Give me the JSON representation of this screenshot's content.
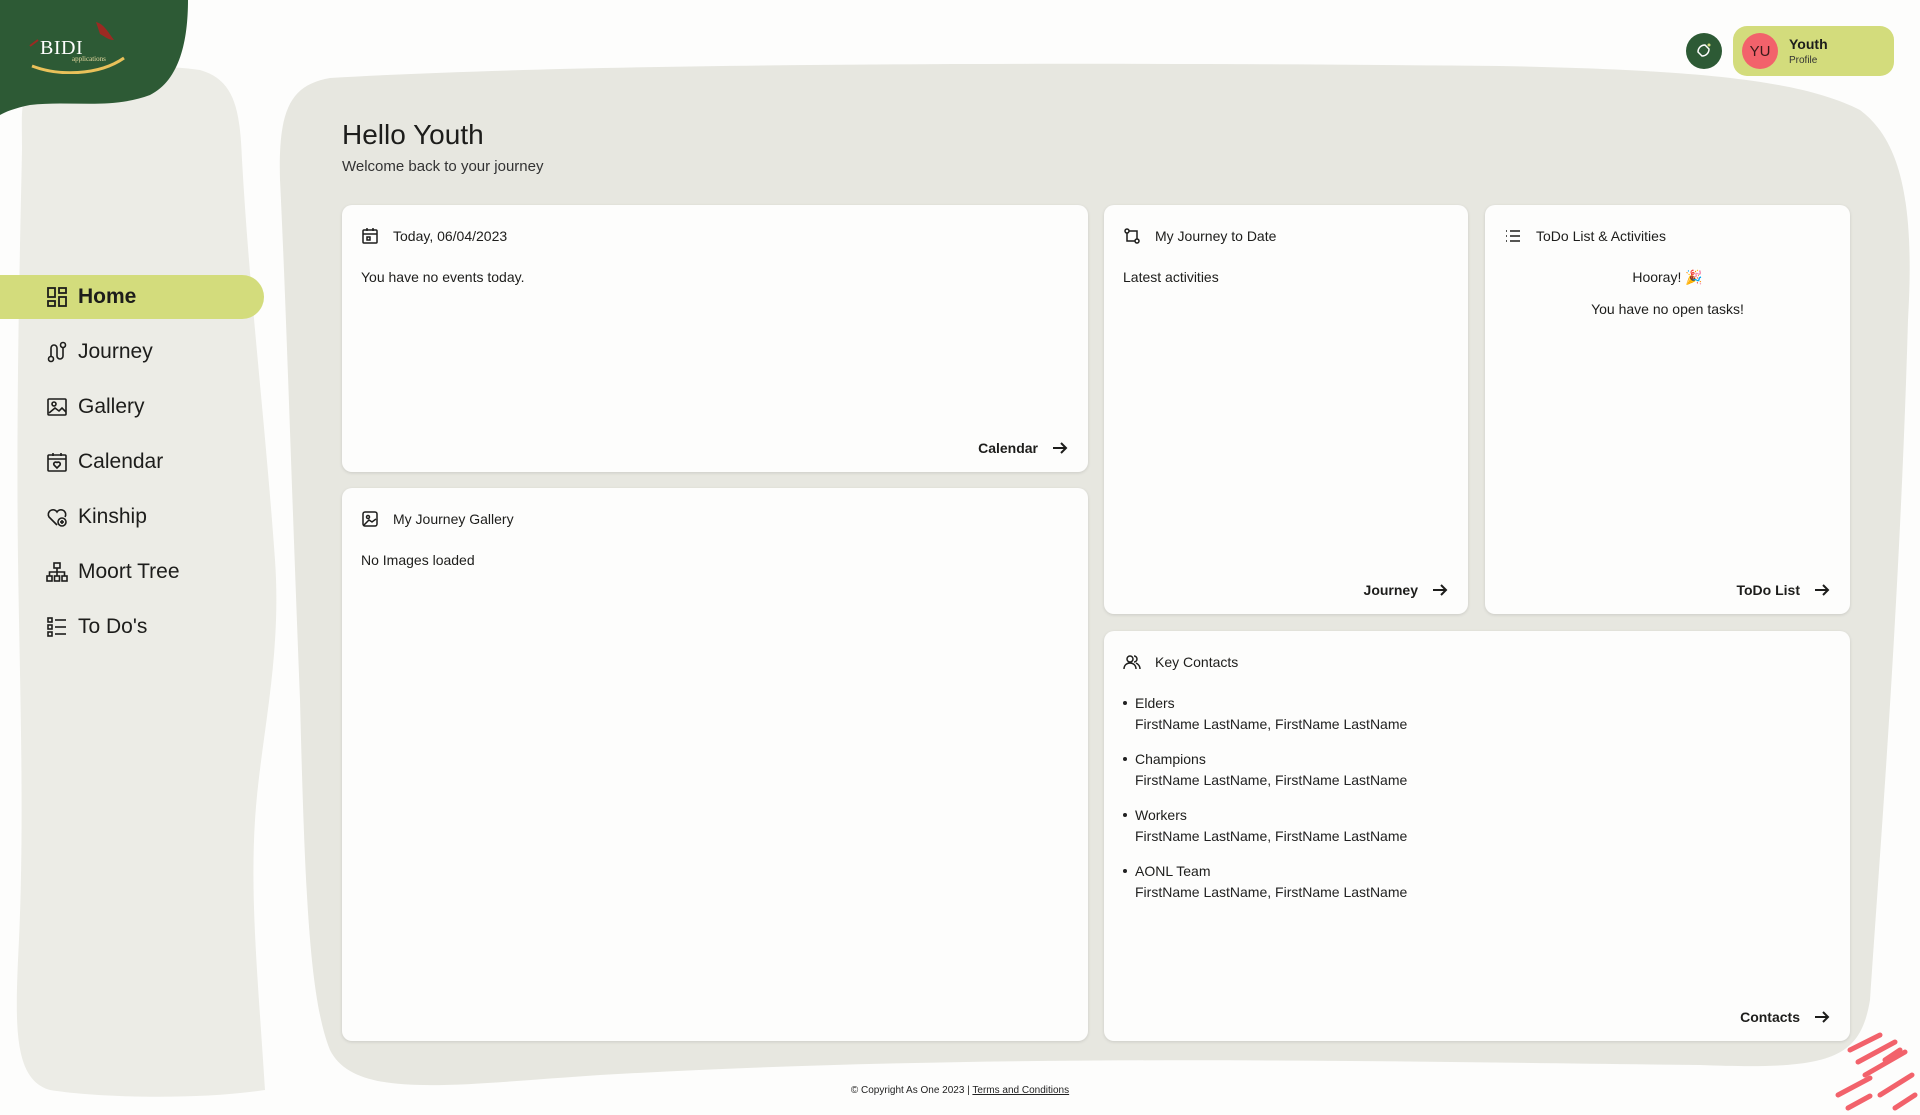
{
  "brand": {
    "logo_text": "BIDI",
    "logo_sub": "applications"
  },
  "colors": {
    "accent": "#d3dc7c",
    "brand_green": "#2d5a35",
    "panel_bg": "#e7e7e0",
    "avatar": "#f2626b"
  },
  "header": {
    "notification_icon": "bell-icon",
    "profile": {
      "initials": "YU",
      "name": "Youth",
      "sub": "Profile"
    }
  },
  "sidebar": {
    "items": [
      {
        "label": "Home",
        "icon": "grid-icon",
        "active": true
      },
      {
        "label": "Journey",
        "icon": "route-icon"
      },
      {
        "label": "Gallery",
        "icon": "image-icon"
      },
      {
        "label": "Calendar",
        "icon": "calendar-heart-icon"
      },
      {
        "label": "Kinship",
        "icon": "heart-plus-icon"
      },
      {
        "label": "Moort Tree",
        "icon": "tree-structure-icon"
      },
      {
        "label": "To Do's",
        "icon": "checklist-icon"
      }
    ]
  },
  "main": {
    "greeting": "Hello Youth",
    "greeting_sub": "Welcome back to your journey",
    "today_card": {
      "title": "Today, 06/04/2023",
      "body": "You have no events today.",
      "link": "Calendar"
    },
    "journey_card": {
      "title": "My Journey to Date",
      "body": "Latest activities",
      "link": "Journey"
    },
    "todo_card": {
      "title": "ToDo List & Activities",
      "body_line1": "Hooray! 🎉",
      "body_line2": "You have no open tasks!",
      "link": "ToDo List"
    },
    "gallery_card": {
      "title": "My Journey Gallery",
      "body": "No Images loaded"
    },
    "contacts_card": {
      "title": "Key Contacts",
      "groups": [
        {
          "role": "Elders",
          "names": "FirstName LastName, FirstName LastName"
        },
        {
          "role": "Champions",
          "names": "FirstName LastName, FirstName LastName"
        },
        {
          "role": "Workers",
          "names": "FirstName LastName, FirstName LastName"
        },
        {
          "role": "AONL Team",
          "names": "FirstName LastName, FirstName LastName"
        }
      ],
      "link": "Contacts"
    }
  },
  "footer": {
    "copyright": "© Copyright As One 2023 |",
    "terms": "Terms and Conditions"
  }
}
